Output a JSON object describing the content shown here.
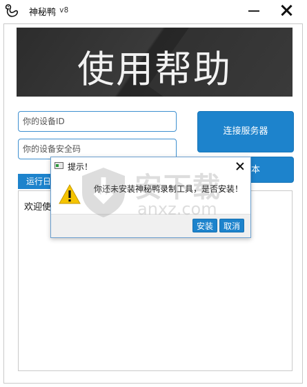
{
  "window": {
    "title": "神秘鸭",
    "version": "v8"
  },
  "banner": {
    "text": "使用帮助"
  },
  "form": {
    "device_id_placeholder": "你的设备ID",
    "device_code_placeholder": "你的设备安全码",
    "connect_label": "连接服务器",
    "script_label": "本"
  },
  "log": {
    "tab_label": "运行日",
    "text": "欢迎使"
  },
  "dialog": {
    "title": "提示！",
    "message": "你还未安装神秘鸭录制工具，是否安装！",
    "install_label": "安装",
    "cancel_label": "取消"
  },
  "watermark": {
    "name": "安下载",
    "domain": "anxz.com"
  },
  "colors": {
    "accent": "#1d83cc",
    "banner_bg": "#2f2f2f",
    "warning": "#f5c400"
  },
  "icons": {
    "app": "duck-icon",
    "minimize": "minimize-icon",
    "close": "close-icon",
    "warning": "warning-icon"
  }
}
